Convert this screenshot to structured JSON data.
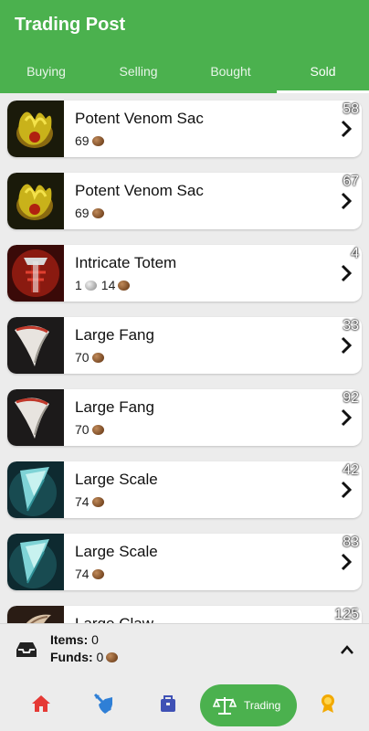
{
  "header": {
    "title": "Trading Post"
  },
  "tabs": [
    {
      "label": "Buying"
    },
    {
      "label": "Selling"
    },
    {
      "label": "Bought"
    },
    {
      "label": "Sold"
    }
  ],
  "active_tab": "Sold",
  "items": [
    {
      "name": "Potent Venom Sac",
      "qty": "58",
      "price": [
        {
          "amount": "69",
          "coin": "copper"
        }
      ],
      "icon": "venom-sac"
    },
    {
      "name": "Potent Venom Sac",
      "qty": "67",
      "price": [
        {
          "amount": "69",
          "coin": "copper"
        }
      ],
      "icon": "venom-sac"
    },
    {
      "name": "Intricate Totem",
      "qty": "4",
      "price": [
        {
          "amount": "1",
          "coin": "silver"
        },
        {
          "amount": "14",
          "coin": "copper"
        }
      ],
      "icon": "totem"
    },
    {
      "name": "Large Fang",
      "qty": "33",
      "price": [
        {
          "amount": "70",
          "coin": "copper"
        }
      ],
      "icon": "fang"
    },
    {
      "name": "Large Fang",
      "qty": "92",
      "price": [
        {
          "amount": "70",
          "coin": "copper"
        }
      ],
      "icon": "fang"
    },
    {
      "name": "Large Scale",
      "qty": "42",
      "price": [
        {
          "amount": "74",
          "coin": "copper"
        }
      ],
      "icon": "scale"
    },
    {
      "name": "Large Scale",
      "qty": "83",
      "price": [
        {
          "amount": "74",
          "coin": "copper"
        }
      ],
      "icon": "scale"
    },
    {
      "name": "Large Claw",
      "qty": "125",
      "price": [],
      "icon": "claw"
    }
  ],
  "summary": {
    "items_label": "Items:",
    "items_value": "0",
    "funds_label": "Funds:",
    "funds_value": "0",
    "funds_coin": "copper"
  },
  "nav": {
    "items": [
      {
        "icon": "home-icon",
        "color": "#e53935"
      },
      {
        "icon": "shield-sword-icon",
        "color": "#2f7fd6"
      },
      {
        "icon": "bag-icon",
        "color": "#3f51b5"
      },
      {
        "icon": "scales-icon",
        "label": "Trading",
        "active": true
      },
      {
        "icon": "achievement-icon",
        "color": "#f2a900"
      }
    ]
  },
  "colors": {
    "accent": "#4bb14e",
    "copper": "#7a4a24",
    "silver": "#a8a8a8"
  }
}
